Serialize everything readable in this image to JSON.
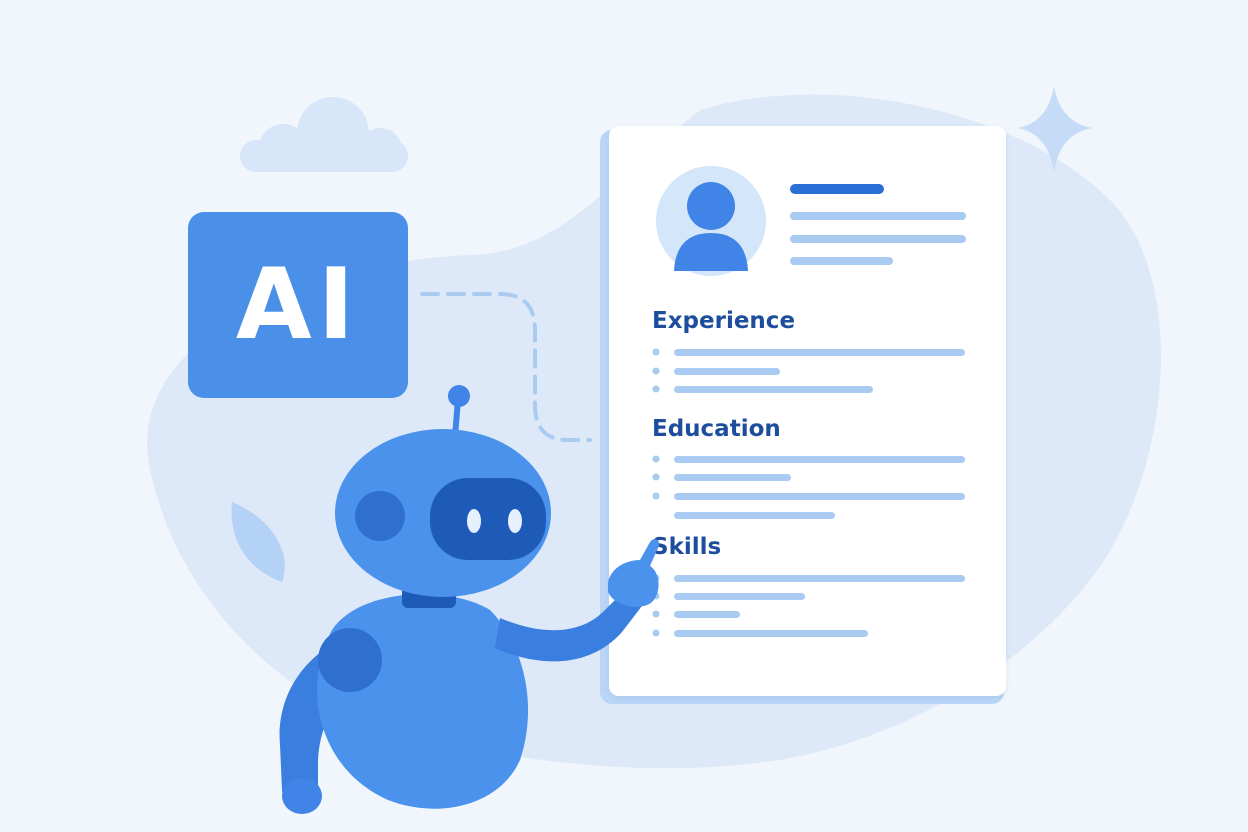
{
  "badge": {
    "label": "AI"
  },
  "resume": {
    "sections": [
      {
        "title": "Experience"
      },
      {
        "title": "Education"
      },
      {
        "title": "Skills"
      }
    ]
  },
  "colors": {
    "background": "#f1f6fc",
    "blob": "#dde9f8",
    "primary": "#4a90e8",
    "robot_body": "#3f84e6",
    "robot_dark": "#1e5bb8",
    "heading": "#1d4e9e",
    "lines": "#a9cbf2"
  },
  "icons": [
    "cloud-icon",
    "sparkle-icon",
    "leaf-icon",
    "avatar-icon",
    "robot-illustration"
  ]
}
